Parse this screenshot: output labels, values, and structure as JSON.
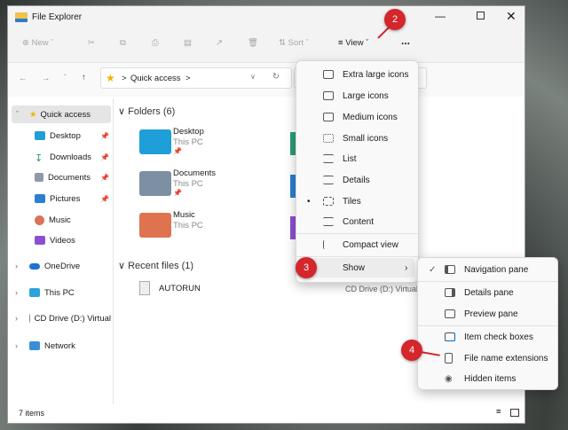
{
  "window": {
    "title": "File Explorer",
    "controls": [
      "minimize",
      "maximize",
      "close"
    ]
  },
  "toolbar": {
    "new": "New",
    "sort": "Sort",
    "view": "View",
    "more": "..."
  },
  "address": {
    "path": "Quick access",
    "separator": ">"
  },
  "nav": {
    "items": [
      {
        "label": "Quick access",
        "pinned": false
      },
      {
        "label": "Desktop",
        "pinned": true
      },
      {
        "label": "Downloads",
        "pinned": true
      },
      {
        "label": "Documents",
        "pinned": true
      },
      {
        "label": "Pictures",
        "pinned": true
      },
      {
        "label": "Music",
        "pinned": false
      },
      {
        "label": "Videos",
        "pinned": false
      },
      {
        "label": "OneDrive"
      },
      {
        "label": "This PC"
      },
      {
        "label": "CD Drive (D:) Virtual"
      },
      {
        "label": "Network"
      }
    ]
  },
  "content": {
    "folders_header": "Folders (6)",
    "folders": [
      {
        "name": "Desktop",
        "location": "This PC",
        "color": "#1e9fd9"
      },
      {
        "name": "Documents",
        "location": "This PC",
        "color": "#7d8fa3"
      },
      {
        "name": "Music",
        "location": "This PC",
        "color": "#e0734f"
      }
    ],
    "recent_header": "Recent files (1)",
    "recent": [
      {
        "name": "AUTORUN",
        "location": "CD Drive (D:) VirtualE"
      }
    ]
  },
  "status": {
    "count": "7 items"
  },
  "view_menu": {
    "items": [
      "Extra large icons",
      "Large icons",
      "Medium icons",
      "Small icons",
      "List",
      "Details",
      "Tiles",
      "Content",
      "Compact view",
      "Show"
    ],
    "selected": "Tiles"
  },
  "show_menu": {
    "items": [
      {
        "label": "Navigation pane",
        "checked": true
      },
      {
        "label": "Details pane",
        "checked": false
      },
      {
        "label": "Preview pane",
        "checked": false
      },
      {
        "label": "Item check boxes",
        "checked": false
      },
      {
        "label": "File name extensions",
        "checked": false
      },
      {
        "label": "Hidden items",
        "checked": false
      }
    ]
  },
  "annotations": [
    "2",
    "3",
    "4"
  ],
  "colors": {
    "badge": "#d4262b",
    "accent": "#0067c0"
  }
}
